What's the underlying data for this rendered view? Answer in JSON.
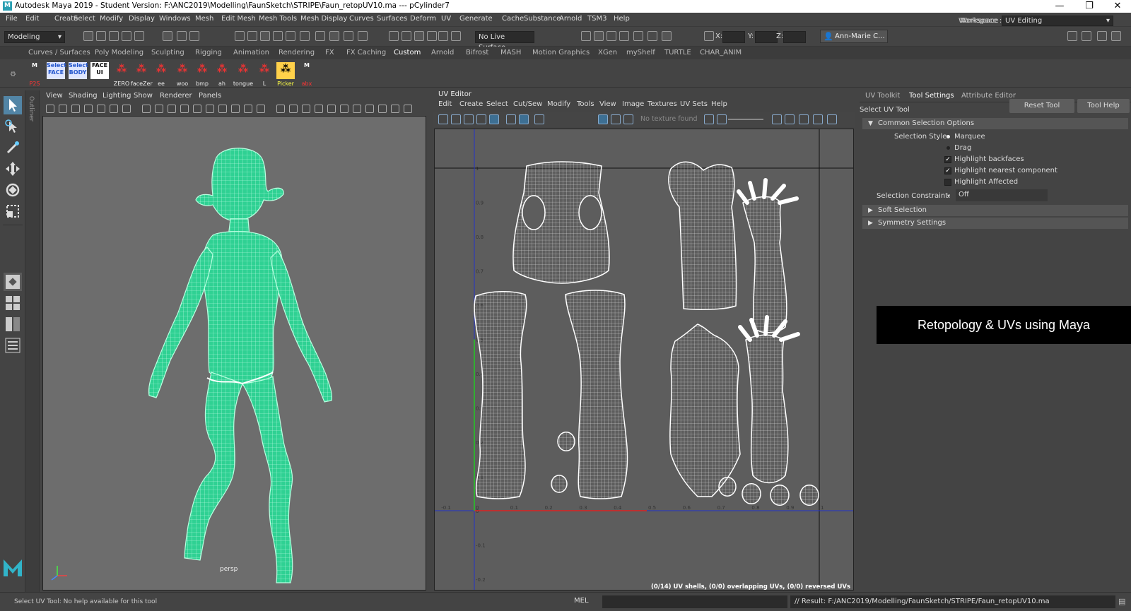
{
  "titlebar": {
    "icon": "M",
    "title": "Autodesk Maya 2019 - Student Version: F:\\ANC2019\\Modelling\\FaunSketch\\STRIPE\\Faun_retopUV10.ma   ---   pCylinder7",
    "minimize": "—",
    "maximize": "❐",
    "close": "✕"
  },
  "menubar": [
    "File",
    "Edit",
    "Create",
    "Select",
    "Modify",
    "Display",
    "Windows",
    "Mesh",
    "Edit Mesh",
    "Mesh Tools",
    "Mesh Display",
    "Curves",
    "Surfaces",
    "Deform",
    "UV",
    "Generate",
    "Cache",
    "Substance",
    "Arnold",
    "TSM3",
    "Help"
  ],
  "workspace": {
    "label": "Workspace :",
    "value": "UV Editing"
  },
  "status": {
    "menuset": "Modeling",
    "live_surface": "No Live Surface",
    "x_label": "X:",
    "y_label": "Y:",
    "z_label": "Z:",
    "user": "Ann-Marie C..."
  },
  "shelf_tabs": [
    "Curves / Surfaces",
    "Poly Modeling",
    "Sculpting",
    "Rigging",
    "Animation",
    "Rendering",
    "FX",
    "FX Caching",
    "Custom",
    "Arnold",
    "Bifrost",
    "MASH",
    "Motion Graphics",
    "XGen",
    "myShelf",
    "TURTLE",
    "CHAR_ANIM"
  ],
  "shelf_active": "Custom",
  "shelf_buttons": [
    {
      "top": "M",
      "label": "P2S"
    },
    {
      "top": "Select FACE",
      "label": ""
    },
    {
      "top": "Select BODY",
      "label": ""
    },
    {
      "top": "FACE UI",
      "label": ""
    },
    {
      "top": "",
      "label": "ZERO"
    },
    {
      "top": "",
      "label": "faceZer"
    },
    {
      "top": "",
      "label": "ee"
    },
    {
      "top": "",
      "label": "woo"
    },
    {
      "top": "",
      "label": "bmp"
    },
    {
      "top": "",
      "label": "ah"
    },
    {
      "top": "",
      "label": "tongue"
    },
    {
      "top": "",
      "label": "L"
    },
    {
      "top": "",
      "label": "Picker"
    },
    {
      "top": "M",
      "label": "abx"
    }
  ],
  "outliner_label": "Outliner",
  "viewport": {
    "menu": [
      "View",
      "Shading",
      "Lighting",
      "Show",
      "Renderer",
      "Panels"
    ],
    "camera_label": "persp"
  },
  "uv_editor": {
    "title": "UV Editor",
    "menu": [
      "Edit",
      "Create",
      "Select",
      "Cut/Sew",
      "Modify",
      "Tools",
      "View",
      "Image",
      "Textures",
      "UV Sets",
      "Help"
    ],
    "texture_status": "No texture found",
    "tick_y": [
      "1",
      "0.9",
      "0.8",
      "0.7",
      "0.6",
      "0.5",
      "0.4",
      "0.3",
      "0.2",
      "0.1",
      "0",
      "-0.1",
      "-0.2"
    ],
    "tick_x": [
      "-0.1",
      "0",
      "0.1",
      "0.2",
      "0.3",
      "0.4",
      "0.5",
      "0.6",
      "0.7",
      "0.8",
      "0.9",
      "1"
    ],
    "shell_info": "(0/14) UV shells, (0/0) overlapping UVs, (0/0) reversed UVs"
  },
  "right_panel": {
    "tabs": [
      "UV Toolkit",
      "Tool Settings",
      "Attribute Editor"
    ],
    "active_tab": "Tool Settings",
    "tool_name": "Select UV Tool",
    "reset_button": "Reset Tool",
    "help_button": "Tool Help",
    "common_section": "Common Selection Options",
    "selection_style_label": "Selection Style:",
    "selection_styles": [
      "Marquee",
      "Drag"
    ],
    "checks": [
      {
        "label": "Highlight backfaces",
        "checked": true
      },
      {
        "label": "Highlight nearest component",
        "checked": true
      },
      {
        "label": "Highlight Affected",
        "checked": false
      }
    ],
    "constraint_label": "Selection Constraint:",
    "constraint_value": "Off",
    "soft_selection": "Soft Selection",
    "symmetry_settings": "Symmetry Settings"
  },
  "banner_text": "Retopology & UVs using Maya",
  "bottom": {
    "help_line": "Select UV Tool: No help available for this tool",
    "mel_label": "MEL",
    "result": "// Result: F:/ANC2019/Modelling/FaunSketch/STRIPE/Faun_retopUV10.ma"
  },
  "colors": {
    "wire": "#3ee6a6",
    "uv_wire": "#ffffff",
    "bg": "#444444",
    "viewport": "#6d6d6d",
    "uvbg": "#5d5d5d"
  }
}
